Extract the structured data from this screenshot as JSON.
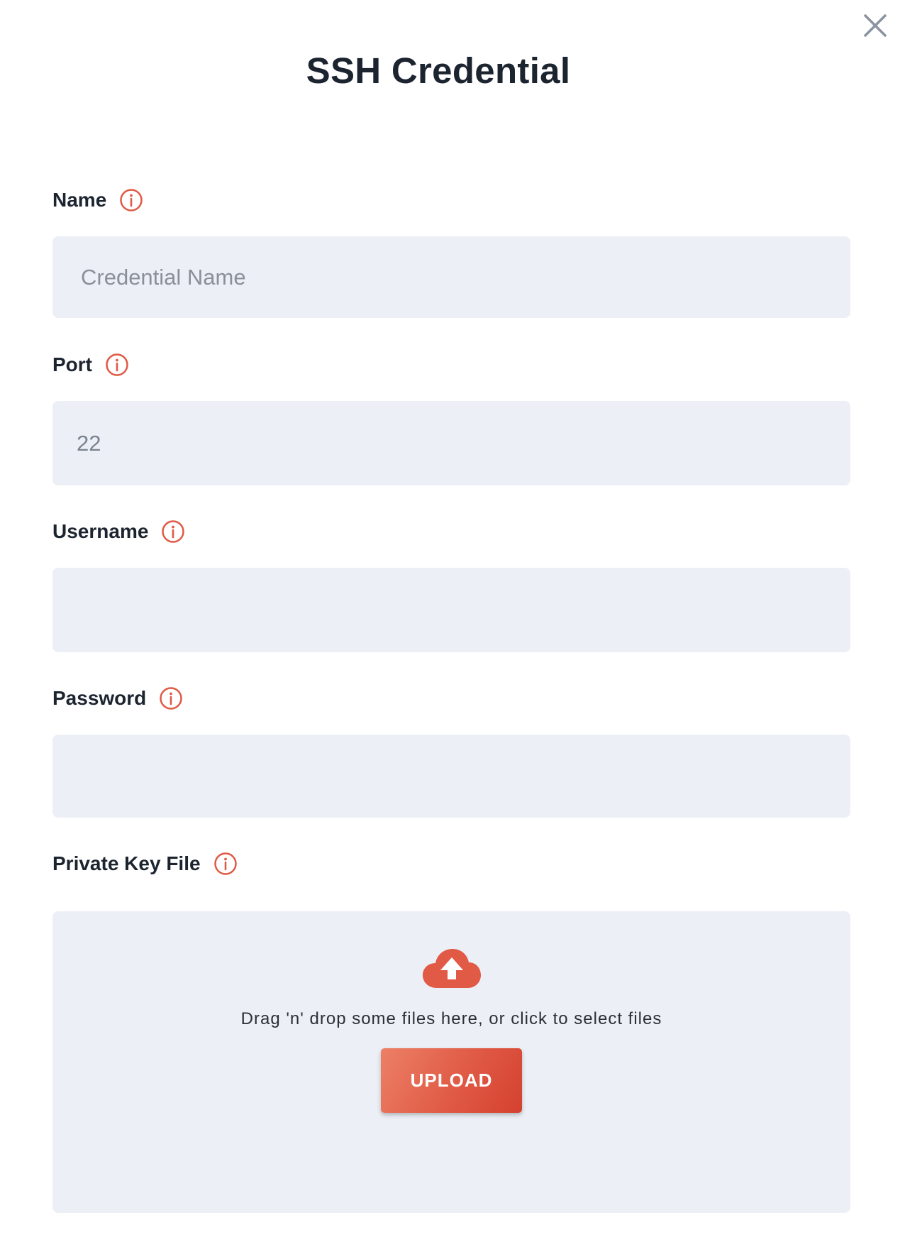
{
  "dialog": {
    "title": "SSH Credential"
  },
  "fields": {
    "name": {
      "label": "Name",
      "value": "",
      "placeholder": "Credential Name"
    },
    "port": {
      "label": "Port",
      "value": "22",
      "placeholder": ""
    },
    "username": {
      "label": "Username",
      "value": "",
      "placeholder": ""
    },
    "password": {
      "label": "Password",
      "value": "",
      "placeholder": ""
    },
    "private_key": {
      "label": "Private Key File",
      "dropzone_text": "Drag 'n' drop some files here, or click to select files",
      "upload_label": "UPLOAD"
    }
  },
  "icons": {
    "close": "close-icon",
    "info": "info-icon",
    "upload": "cloud-upload-icon"
  },
  "colors": {
    "accent": "#e05a45",
    "input_bg": "#ecf0f6",
    "title": "#1c2430",
    "close": "#8a93a0"
  }
}
